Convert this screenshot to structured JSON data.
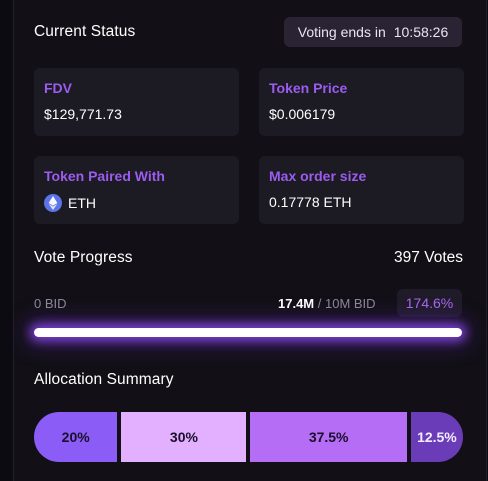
{
  "status": {
    "title": "Current Status",
    "timer_label": "Voting ends in",
    "timer_value": "10:58:26"
  },
  "cards": {
    "fdv": {
      "label": "FDV",
      "value": "$129,771.73"
    },
    "token_price": {
      "label": "Token Price",
      "value": "$0.006179"
    },
    "paired": {
      "label": "Token Paired With",
      "value": "ETH",
      "icon": "eth-icon"
    },
    "max_order": {
      "label": "Max order size",
      "value": "0.17778 ETH"
    }
  },
  "vote": {
    "title": "Vote Progress",
    "votes": "397 Votes",
    "bid_min": "0 BID",
    "bid_current": "17.4M",
    "bid_sep": " / ",
    "bid_target": "10M BID",
    "percent": "174.6%",
    "progress_fraction": 1.0
  },
  "allocation": {
    "title": "Allocation Summary",
    "segments": [
      {
        "label": "20%",
        "value": 20,
        "color": "#8b5cf6"
      },
      {
        "label": "30%",
        "value": 30,
        "color": "#e2b0ff"
      },
      {
        "label": "37.5%",
        "value": 37.5,
        "color": "#b56df5"
      },
      {
        "label": "12.5%",
        "value": 12.5,
        "color": "#6b3cb8"
      }
    ]
  },
  "colors": {
    "accent": "#9b5cf0",
    "background": "#0d0b12",
    "card": "#1c1a22"
  }
}
